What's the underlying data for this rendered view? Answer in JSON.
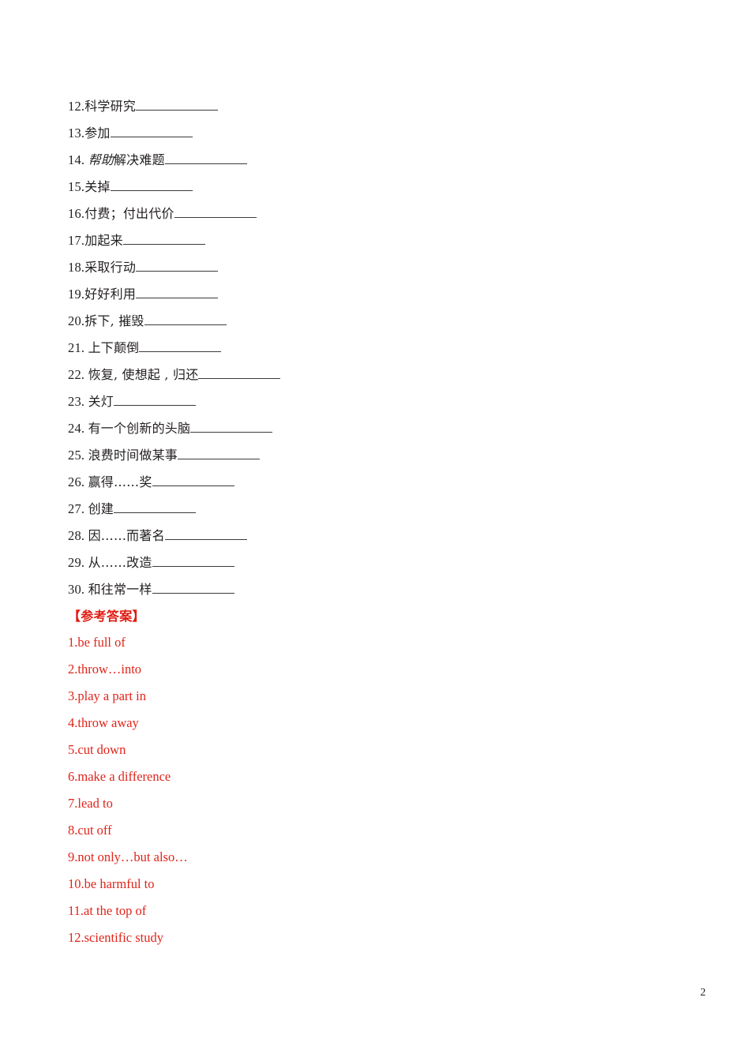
{
  "document": {
    "page_number": "2",
    "answer_accent_color": "#e0241a",
    "text_color": "#231f20"
  },
  "vocabulary": {
    "items": [
      {
        "number": "12.",
        "term": "科学研究",
        "italic_prefix": "",
        "blank": "long"
      },
      {
        "number": "13.",
        "term": "参加",
        "italic_prefix": "",
        "blank": "long"
      },
      {
        "number": "14. ",
        "term": "解决难题",
        "italic_prefix": "帮助",
        "blank": "long"
      },
      {
        "number": "15.",
        "term": "关掉",
        "italic_prefix": "",
        "blank": "long"
      },
      {
        "number": "16.",
        "term": "付费；付出代价",
        "italic_prefix": "",
        "blank": "long"
      },
      {
        "number": "17.",
        "term": "加起来",
        "italic_prefix": "",
        "blank": "long"
      },
      {
        "number": "18.",
        "term": "采取行动",
        "italic_prefix": "",
        "blank": "long"
      },
      {
        "number": "19.",
        "term": "好好利用",
        "italic_prefix": "",
        "blank": "long"
      },
      {
        "number": "20.",
        "term": "拆下, 摧毁",
        "italic_prefix": "",
        "blank": "long"
      },
      {
        "number": "21. ",
        "term": "上下颠倒",
        "italic_prefix": "",
        "blank": "long"
      },
      {
        "number": "22. ",
        "term": "恢复, 使想起 , 归还",
        "italic_prefix": "",
        "blank": "long"
      },
      {
        "number": "23. ",
        "term": "关灯",
        "italic_prefix": "",
        "blank": "long"
      },
      {
        "number": "24. ",
        "term": "有一个创新的头脑",
        "italic_prefix": "",
        "blank": "long"
      },
      {
        "number": "25. ",
        "term": "浪费时间做某事",
        "italic_prefix": "",
        "blank": "long"
      },
      {
        "number": "26. ",
        "term": "赢得……奖",
        "italic_prefix": "",
        "blank": "long"
      },
      {
        "number": "27. ",
        "term": "创建",
        "italic_prefix": "",
        "blank": "long"
      },
      {
        "number": "28. ",
        "term": "因……而著名",
        "italic_prefix": "",
        "blank": "long"
      },
      {
        "number": "29. ",
        "term": "从……改造",
        "italic_prefix": "",
        "blank": "long"
      },
      {
        "number": "30. ",
        "term": "和往常一样",
        "italic_prefix": "",
        "blank": "long"
      }
    ]
  },
  "answer_key": {
    "header": "【参考答案】",
    "items": [
      "1.be full of",
      "2.throw…into",
      "3.play a part in",
      "4.throw away",
      "5.cut down",
      "6.make a difference",
      "7.lead to",
      "8.cut off",
      "9.not only…but also…",
      "10.be harmful to",
      "11.at the top of",
      "12.scientific study"
    ]
  }
}
